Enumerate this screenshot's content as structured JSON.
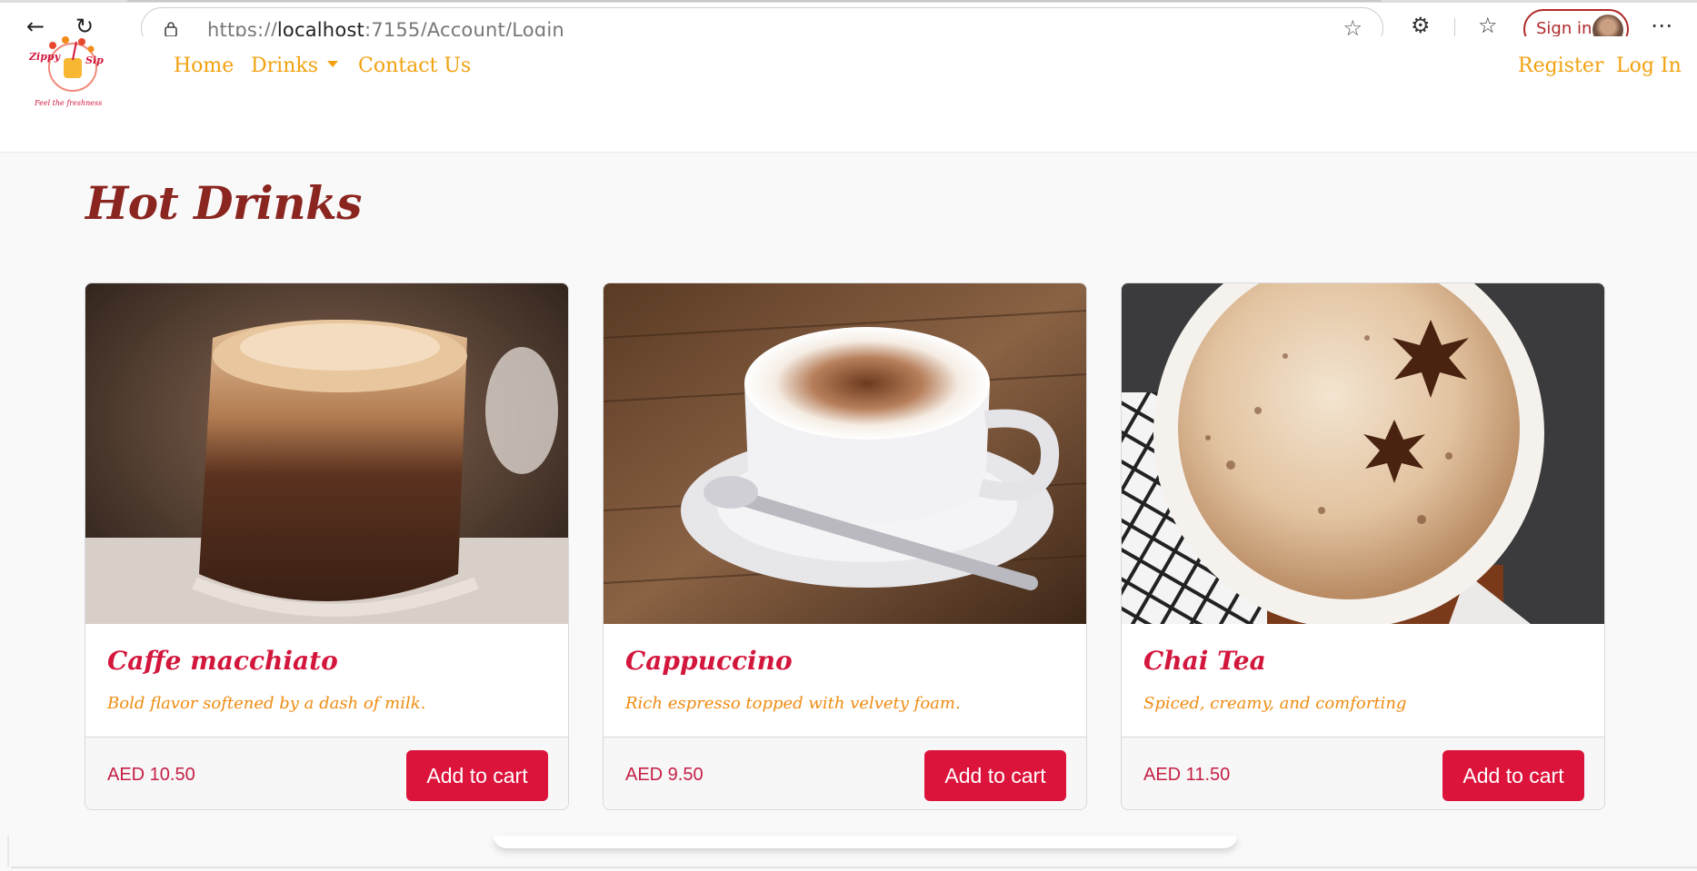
{
  "browser": {
    "url_prefix": "https://",
    "url_host": "localhost",
    "url_rest": ":7155/Account/Login",
    "signin_label": "Sign in"
  },
  "navbar": {
    "logo_text_top": "Zippy Sip",
    "logo_tagline": "Feel the freshness",
    "links": [
      {
        "label": "Home"
      },
      {
        "label": "Drinks"
      },
      {
        "label": "Contact Us"
      }
    ],
    "right_links": [
      {
        "label": "Register"
      },
      {
        "label": "Log In"
      }
    ]
  },
  "page": {
    "title": "Hot Drinks"
  },
  "products": [
    {
      "name": "Caffe macchiato",
      "description": "Bold flavor softened by a dash of milk.",
      "price": "AED 10.50",
      "button": "Add to cart"
    },
    {
      "name": "Cappuccino",
      "description": "Rich espresso topped with velvety foam.",
      "price": "AED 9.50",
      "button": "Add to cart"
    },
    {
      "name": "Chai Tea",
      "description": "Spiced, creamy, and comforting",
      "price": "AED 11.50",
      "button": "Add to cart"
    }
  ],
  "colors": {
    "nav_link": "#f2a10f",
    "title": "#8b2520",
    "product_name": "#d3163c",
    "description": "#ef8c12",
    "button": "#dc143c"
  }
}
